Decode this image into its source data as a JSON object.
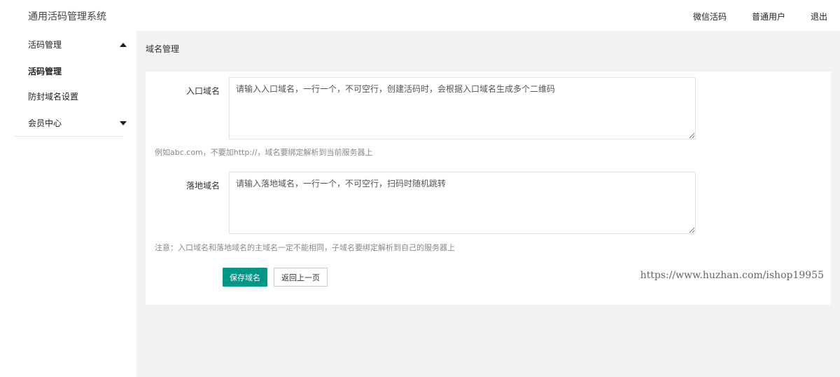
{
  "header": {
    "app_title": "通用活码管理系统",
    "nav": [
      "微信活码",
      "普通用户",
      "退出"
    ]
  },
  "sidebar": {
    "group_1": "活码管理",
    "items": [
      "活码管理",
      "防封域名设置"
    ],
    "group_2": "会员中心"
  },
  "main": {
    "breadcrumb": "域名管理",
    "form": {
      "entry_label": "入口域名",
      "entry_value": "",
      "entry_placeholder": "请输入入口域名，一行一个，不可空行，创建活码时，会根据入口域名生成多个二维码",
      "entry_hint": "例如abc.com，不要加http://，域名要绑定解析到当前服务器上",
      "landing_label": "落地域名",
      "landing_value": "",
      "landing_placeholder": "请输入落地域名，一行一个，不可空行，扫码时随机跳转",
      "landing_hint": "注意：入口域名和落地域名的主域名一定不能相同，子域名要绑定解析到自己的服务器上",
      "save_label": "保存域名",
      "back_label": "返回上一页"
    },
    "watermark": "https://www.huzhan.com/ishop19955"
  }
}
